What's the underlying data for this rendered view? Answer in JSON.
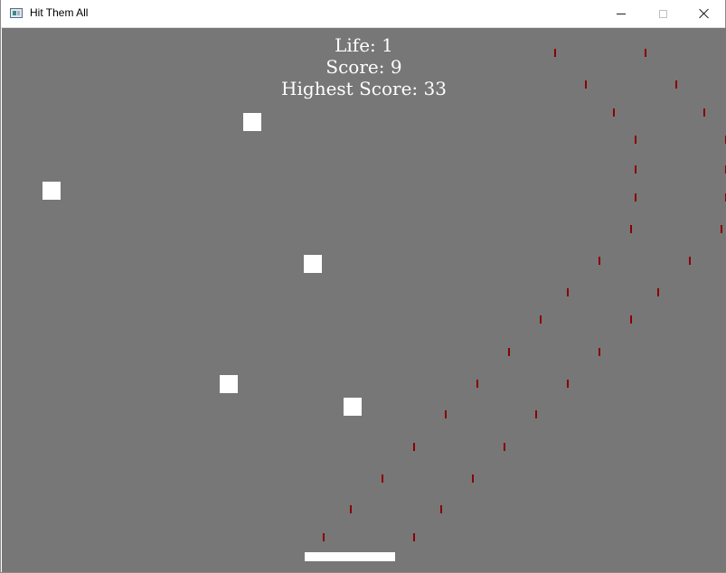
{
  "window": {
    "title": "Hit Them All",
    "controls": {
      "minimize": "minimize",
      "maximize": "maximize",
      "close": "close"
    }
  },
  "hud": {
    "life": "Life: 1",
    "score": "Score: 9",
    "highest": "Highest Score: 33"
  },
  "colors": {
    "background": "#777777",
    "blocks": "#ffffff",
    "paddle": "#ffffff",
    "bullets": "#8b0000"
  },
  "counts": {
    "blocks": 5,
    "bullet_streams": 2
  }
}
